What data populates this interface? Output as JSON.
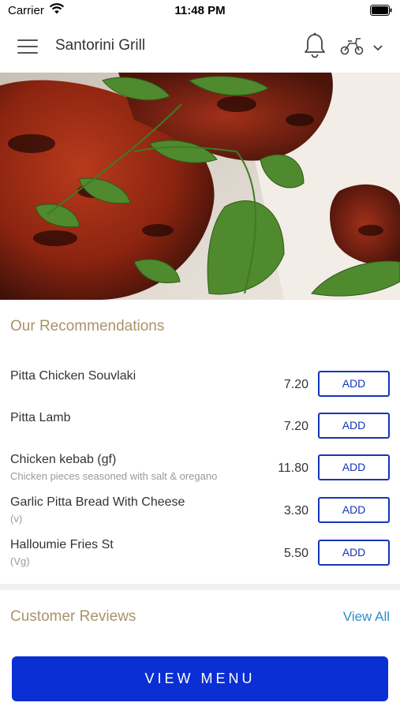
{
  "status_bar": {
    "carrier": "Carrier",
    "time": "11:48 PM"
  },
  "header": {
    "title": "Santorini Grill"
  },
  "recommendations": {
    "heading": "Our Recommendations",
    "items": [
      {
        "name": "Pitta Chicken Souvlaki",
        "description": "",
        "price": "7.20",
        "button": "ADD"
      },
      {
        "name": "Pitta Lamb",
        "description": "",
        "price": "7.20",
        "button": "ADD"
      },
      {
        "name": "Chicken kebab (gf)",
        "description": "Chicken pieces seasoned with salt & oregano",
        "price": "11.80",
        "button": "ADD"
      },
      {
        "name": "Garlic Pitta Bread With Cheese",
        "description": "(v)",
        "price": "3.30",
        "button": "ADD"
      },
      {
        "name": "Halloumie Fries St",
        "description": "(Vg)",
        "price": "5.50",
        "button": "ADD"
      }
    ]
  },
  "reviews": {
    "heading": "Customer Reviews",
    "view_all": "View All"
  },
  "footer": {
    "view_menu": "VIEW MENU"
  },
  "icons": {
    "wifi": "wifi-icon",
    "battery": "battery-icon",
    "menu": "hamburger-menu-icon",
    "bell": "bell-icon",
    "delivery": "scooter-icon",
    "chevron": "chevron-down-icon"
  },
  "colors": {
    "accent_blue": "#1534b8",
    "button_blue": "#0a2fd4",
    "heading_gold": "#a9946a",
    "link_blue": "#2b8ec9"
  }
}
